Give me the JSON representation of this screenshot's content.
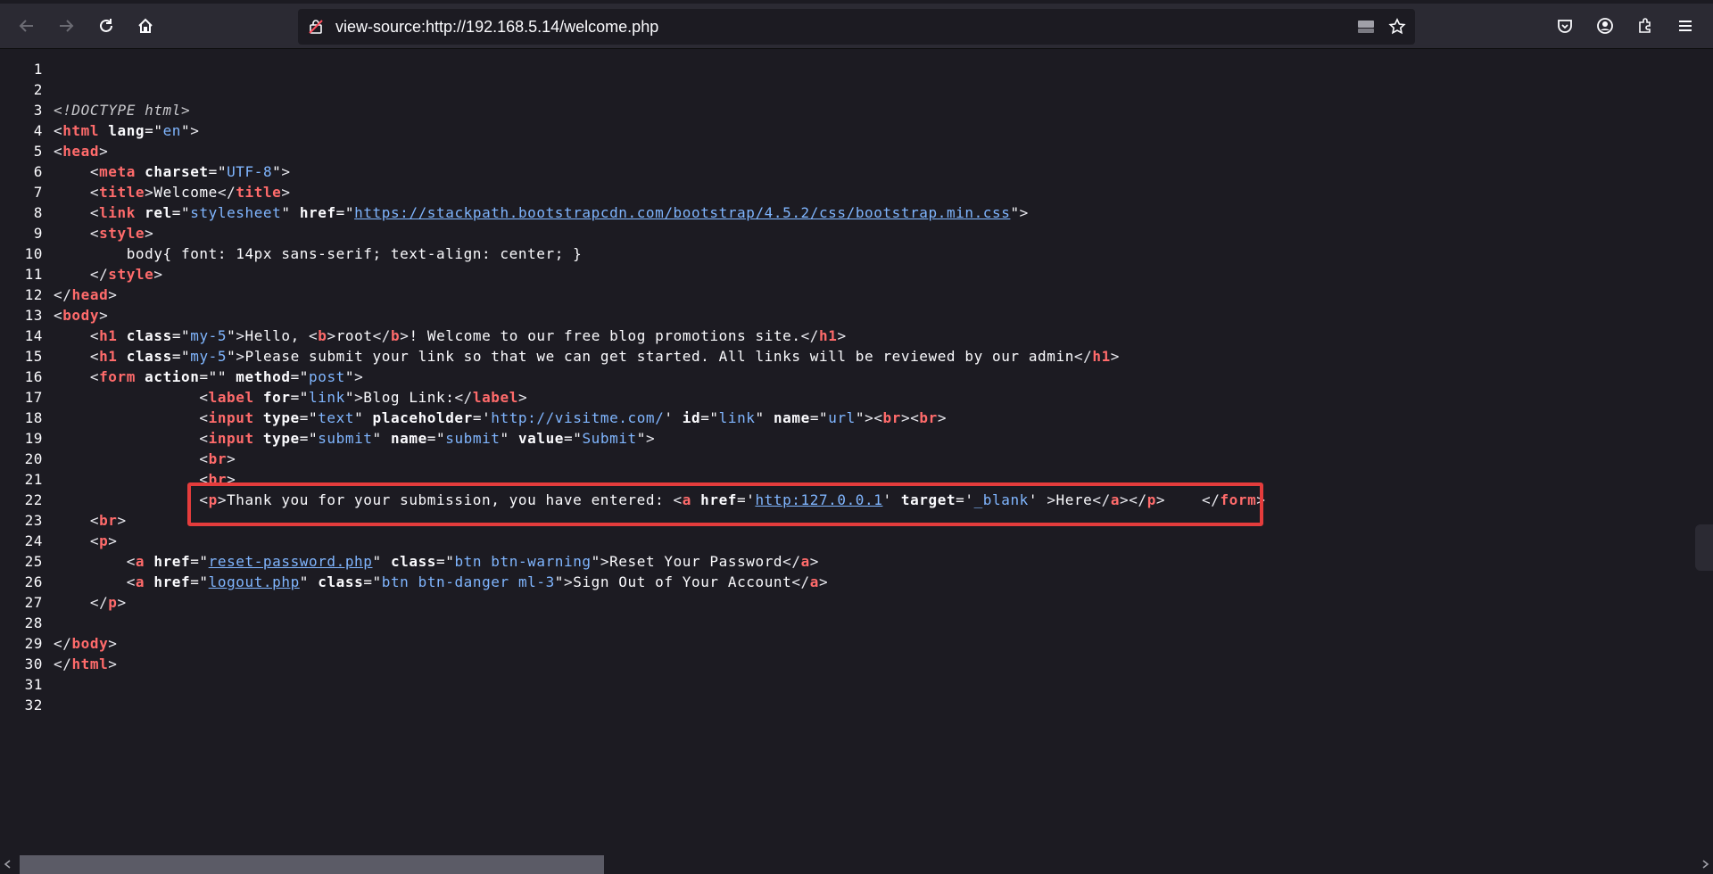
{
  "browser": {
    "url": "view-source:http://192.168.5.14/welcome.php"
  },
  "source_lines": [
    {
      "n": "1",
      "parts": []
    },
    {
      "n": "2",
      "parts": []
    },
    {
      "n": "3",
      "parts": [
        {
          "c": "doctype",
          "t": "<!DOCTYPE html>"
        }
      ]
    },
    {
      "n": "4",
      "parts": [
        {
          "c": "br",
          "t": "<"
        },
        {
          "c": "tag",
          "t": "html"
        },
        {
          "c": "t",
          "t": " "
        },
        {
          "c": "attr",
          "t": "lang"
        },
        {
          "c": "t",
          "t": "=\""
        },
        {
          "c": "val",
          "t": "en"
        },
        {
          "c": "t",
          "t": "\""
        },
        {
          "c": "br",
          "t": ">"
        }
      ]
    },
    {
      "n": "5",
      "parts": [
        {
          "c": "br",
          "t": "<"
        },
        {
          "c": "tag",
          "t": "head"
        },
        {
          "c": "br",
          "t": ">"
        }
      ]
    },
    {
      "n": "6",
      "parts": [
        {
          "c": "t",
          "t": "    "
        },
        {
          "c": "br",
          "t": "<"
        },
        {
          "c": "tag",
          "t": "meta"
        },
        {
          "c": "t",
          "t": " "
        },
        {
          "c": "attr",
          "t": "charset"
        },
        {
          "c": "t",
          "t": "=\""
        },
        {
          "c": "val",
          "t": "UTF-8"
        },
        {
          "c": "t",
          "t": "\""
        },
        {
          "c": "br",
          "t": ">"
        }
      ]
    },
    {
      "n": "7",
      "parts": [
        {
          "c": "t",
          "t": "    "
        },
        {
          "c": "br",
          "t": "<"
        },
        {
          "c": "tag",
          "t": "title"
        },
        {
          "c": "br",
          "t": ">"
        },
        {
          "c": "t",
          "t": "Welcome"
        },
        {
          "c": "br",
          "t": "</"
        },
        {
          "c": "tag",
          "t": "title"
        },
        {
          "c": "br",
          "t": ">"
        }
      ]
    },
    {
      "n": "8",
      "parts": [
        {
          "c": "t",
          "t": "    "
        },
        {
          "c": "br",
          "t": "<"
        },
        {
          "c": "tag",
          "t": "link"
        },
        {
          "c": "t",
          "t": " "
        },
        {
          "c": "attr",
          "t": "rel"
        },
        {
          "c": "t",
          "t": "=\""
        },
        {
          "c": "val",
          "t": "stylesheet"
        },
        {
          "c": "t",
          "t": "\" "
        },
        {
          "c": "attr",
          "t": "href"
        },
        {
          "c": "t",
          "t": "=\""
        },
        {
          "c": "link",
          "t": "https://stackpath.bootstrapcdn.com/bootstrap/4.5.2/css/bootstrap.min.css"
        },
        {
          "c": "t",
          "t": "\""
        },
        {
          "c": "br",
          "t": ">"
        }
      ]
    },
    {
      "n": "9",
      "parts": [
        {
          "c": "t",
          "t": "    "
        },
        {
          "c": "br",
          "t": "<"
        },
        {
          "c": "tag",
          "t": "style"
        },
        {
          "c": "br",
          "t": ">"
        }
      ]
    },
    {
      "n": "10",
      "parts": [
        {
          "c": "t",
          "t": "        body{ font: 14px sans-serif; text-align: center; }"
        }
      ]
    },
    {
      "n": "11",
      "parts": [
        {
          "c": "t",
          "t": "    "
        },
        {
          "c": "br",
          "t": "</"
        },
        {
          "c": "tag",
          "t": "style"
        },
        {
          "c": "br",
          "t": ">"
        }
      ]
    },
    {
      "n": "12",
      "parts": [
        {
          "c": "br",
          "t": "</"
        },
        {
          "c": "tag",
          "t": "head"
        },
        {
          "c": "br",
          "t": ">"
        }
      ]
    },
    {
      "n": "13",
      "parts": [
        {
          "c": "br",
          "t": "<"
        },
        {
          "c": "tag",
          "t": "body"
        },
        {
          "c": "br",
          "t": ">"
        }
      ]
    },
    {
      "n": "14",
      "parts": [
        {
          "c": "t",
          "t": "    "
        },
        {
          "c": "br",
          "t": "<"
        },
        {
          "c": "tag",
          "t": "h1"
        },
        {
          "c": "t",
          "t": " "
        },
        {
          "c": "attr",
          "t": "class"
        },
        {
          "c": "t",
          "t": "=\""
        },
        {
          "c": "val",
          "t": "my-5"
        },
        {
          "c": "t",
          "t": "\""
        },
        {
          "c": "br",
          "t": ">"
        },
        {
          "c": "t",
          "t": "Hello, "
        },
        {
          "c": "br",
          "t": "<"
        },
        {
          "c": "tag",
          "t": "b"
        },
        {
          "c": "br",
          "t": ">"
        },
        {
          "c": "t",
          "t": "root"
        },
        {
          "c": "br",
          "t": "</"
        },
        {
          "c": "tag",
          "t": "b"
        },
        {
          "c": "br",
          "t": ">"
        },
        {
          "c": "t",
          "t": "! Welcome to our free blog promotions site."
        },
        {
          "c": "br",
          "t": "</"
        },
        {
          "c": "tag",
          "t": "h1"
        },
        {
          "c": "br",
          "t": ">"
        }
      ]
    },
    {
      "n": "15",
      "parts": [
        {
          "c": "t",
          "t": "    "
        },
        {
          "c": "br",
          "t": "<"
        },
        {
          "c": "tag",
          "t": "h1"
        },
        {
          "c": "t",
          "t": " "
        },
        {
          "c": "attr",
          "t": "class"
        },
        {
          "c": "t",
          "t": "=\""
        },
        {
          "c": "val",
          "t": "my-5"
        },
        {
          "c": "t",
          "t": "\""
        },
        {
          "c": "br",
          "t": ">"
        },
        {
          "c": "t",
          "t": "Please submit your link so that we can get started. All links will be reviewed by our admin"
        },
        {
          "c": "br",
          "t": "</"
        },
        {
          "c": "tag",
          "t": "h1"
        },
        {
          "c": "br",
          "t": ">"
        }
      ]
    },
    {
      "n": "16",
      "parts": [
        {
          "c": "t",
          "t": "    "
        },
        {
          "c": "br",
          "t": "<"
        },
        {
          "c": "tag",
          "t": "form"
        },
        {
          "c": "t",
          "t": " "
        },
        {
          "c": "attr",
          "t": "action"
        },
        {
          "c": "t",
          "t": "=\"\" "
        },
        {
          "c": "attr",
          "t": "method"
        },
        {
          "c": "t",
          "t": "=\""
        },
        {
          "c": "val",
          "t": "post"
        },
        {
          "c": "t",
          "t": "\""
        },
        {
          "c": "br",
          "t": ">"
        }
      ]
    },
    {
      "n": "17",
      "parts": [
        {
          "c": "t",
          "t": "                "
        },
        {
          "c": "br",
          "t": "<"
        },
        {
          "c": "tag",
          "t": "label"
        },
        {
          "c": "t",
          "t": " "
        },
        {
          "c": "attr",
          "t": "for"
        },
        {
          "c": "t",
          "t": "=\""
        },
        {
          "c": "val",
          "t": "link"
        },
        {
          "c": "t",
          "t": "\""
        },
        {
          "c": "br",
          "t": ">"
        },
        {
          "c": "t",
          "t": "Blog Link:"
        },
        {
          "c": "br",
          "t": "</"
        },
        {
          "c": "tag",
          "t": "label"
        },
        {
          "c": "br",
          "t": ">"
        }
      ]
    },
    {
      "n": "18",
      "parts": [
        {
          "c": "t",
          "t": "                "
        },
        {
          "c": "br",
          "t": "<"
        },
        {
          "c": "tag",
          "t": "input"
        },
        {
          "c": "t",
          "t": " "
        },
        {
          "c": "attr",
          "t": "type"
        },
        {
          "c": "t",
          "t": "=\""
        },
        {
          "c": "val",
          "t": "text"
        },
        {
          "c": "t",
          "t": "\" "
        },
        {
          "c": "attr",
          "t": "placeholder"
        },
        {
          "c": "t",
          "t": "='"
        },
        {
          "c": "val",
          "t": "http://visitme.com/"
        },
        {
          "c": "t",
          "t": "' "
        },
        {
          "c": "attr",
          "t": "id"
        },
        {
          "c": "t",
          "t": "=\""
        },
        {
          "c": "val",
          "t": "link"
        },
        {
          "c": "t",
          "t": "\" "
        },
        {
          "c": "attr",
          "t": "name"
        },
        {
          "c": "t",
          "t": "=\""
        },
        {
          "c": "val",
          "t": "url"
        },
        {
          "c": "t",
          "t": "\""
        },
        {
          "c": "br",
          "t": ">"
        },
        {
          "c": "br",
          "t": "<"
        },
        {
          "c": "tag",
          "t": "br"
        },
        {
          "c": "br",
          "t": ">"
        },
        {
          "c": "br",
          "t": "<"
        },
        {
          "c": "tag",
          "t": "br"
        },
        {
          "c": "br",
          "t": ">"
        }
      ]
    },
    {
      "n": "19",
      "parts": [
        {
          "c": "t",
          "t": "                "
        },
        {
          "c": "br",
          "t": "<"
        },
        {
          "c": "tag",
          "t": "input"
        },
        {
          "c": "t",
          "t": " "
        },
        {
          "c": "attr",
          "t": "type"
        },
        {
          "c": "t",
          "t": "=\""
        },
        {
          "c": "val",
          "t": "submit"
        },
        {
          "c": "t",
          "t": "\" "
        },
        {
          "c": "attr",
          "t": "name"
        },
        {
          "c": "t",
          "t": "=\""
        },
        {
          "c": "val",
          "t": "submit"
        },
        {
          "c": "t",
          "t": "\" "
        },
        {
          "c": "attr",
          "t": "value"
        },
        {
          "c": "t",
          "t": "=\""
        },
        {
          "c": "val",
          "t": "Submit"
        },
        {
          "c": "t",
          "t": "\""
        },
        {
          "c": "br",
          "t": ">"
        }
      ]
    },
    {
      "n": "20",
      "parts": [
        {
          "c": "t",
          "t": "                "
        },
        {
          "c": "br",
          "t": "<"
        },
        {
          "c": "tag",
          "t": "br"
        },
        {
          "c": "br",
          "t": ">"
        }
      ]
    },
    {
      "n": "21",
      "parts": [
        {
          "c": "t",
          "t": "                "
        },
        {
          "c": "br",
          "t": "<"
        },
        {
          "c": "tag",
          "t": "br"
        },
        {
          "c": "br",
          "t": ">"
        }
      ]
    },
    {
      "n": "22",
      "parts": [
        {
          "c": "t",
          "t": "                "
        },
        {
          "c": "br",
          "t": "<"
        },
        {
          "c": "tag",
          "t": "p"
        },
        {
          "c": "br",
          "t": ">"
        },
        {
          "c": "t",
          "t": "Thank you for your submission, you have entered: "
        },
        {
          "c": "br",
          "t": "<"
        },
        {
          "c": "tag",
          "t": "a"
        },
        {
          "c": "t",
          "t": " "
        },
        {
          "c": "attr",
          "t": "href"
        },
        {
          "c": "t",
          "t": "='"
        },
        {
          "c": "link",
          "t": "http:127.0.0.1"
        },
        {
          "c": "t",
          "t": "' "
        },
        {
          "c": "attr",
          "t": "target"
        },
        {
          "c": "t",
          "t": "='"
        },
        {
          "c": "val",
          "t": "_blank"
        },
        {
          "c": "t",
          "t": "' "
        },
        {
          "c": "br",
          "t": ">"
        },
        {
          "c": "t",
          "t": "Here"
        },
        {
          "c": "br",
          "t": "</"
        },
        {
          "c": "tag",
          "t": "a"
        },
        {
          "c": "br",
          "t": ">"
        },
        {
          "c": "br",
          "t": "</"
        },
        {
          "c": "tag",
          "t": "p"
        },
        {
          "c": "br",
          "t": ">"
        },
        {
          "c": "t",
          "t": "    "
        },
        {
          "c": "br",
          "t": "</"
        },
        {
          "c": "tag",
          "t": "form"
        },
        {
          "c": "br",
          "t": ">"
        }
      ]
    },
    {
      "n": "23",
      "parts": [
        {
          "c": "t",
          "t": "    "
        },
        {
          "c": "br",
          "t": "<"
        },
        {
          "c": "tag",
          "t": "br"
        },
        {
          "c": "br",
          "t": ">"
        }
      ]
    },
    {
      "n": "24",
      "parts": [
        {
          "c": "t",
          "t": "    "
        },
        {
          "c": "br",
          "t": "<"
        },
        {
          "c": "tag",
          "t": "p"
        },
        {
          "c": "br",
          "t": ">"
        }
      ]
    },
    {
      "n": "25",
      "parts": [
        {
          "c": "t",
          "t": "        "
        },
        {
          "c": "br",
          "t": "<"
        },
        {
          "c": "tag",
          "t": "a"
        },
        {
          "c": "t",
          "t": " "
        },
        {
          "c": "attr",
          "t": "href"
        },
        {
          "c": "t",
          "t": "=\""
        },
        {
          "c": "link",
          "t": "reset-password.php"
        },
        {
          "c": "t",
          "t": "\" "
        },
        {
          "c": "attr",
          "t": "class"
        },
        {
          "c": "t",
          "t": "=\""
        },
        {
          "c": "val",
          "t": "btn btn-warning"
        },
        {
          "c": "t",
          "t": "\""
        },
        {
          "c": "br",
          "t": ">"
        },
        {
          "c": "t",
          "t": "Reset Your Password"
        },
        {
          "c": "br",
          "t": "</"
        },
        {
          "c": "tag",
          "t": "a"
        },
        {
          "c": "br",
          "t": ">"
        }
      ]
    },
    {
      "n": "26",
      "parts": [
        {
          "c": "t",
          "t": "        "
        },
        {
          "c": "br",
          "t": "<"
        },
        {
          "c": "tag",
          "t": "a"
        },
        {
          "c": "t",
          "t": " "
        },
        {
          "c": "attr",
          "t": "href"
        },
        {
          "c": "t",
          "t": "=\""
        },
        {
          "c": "link",
          "t": "logout.php"
        },
        {
          "c": "t",
          "t": "\" "
        },
        {
          "c": "attr",
          "t": "class"
        },
        {
          "c": "t",
          "t": "=\""
        },
        {
          "c": "val",
          "t": "btn btn-danger ml-3"
        },
        {
          "c": "t",
          "t": "\""
        },
        {
          "c": "br",
          "t": ">"
        },
        {
          "c": "t",
          "t": "Sign Out of Your Account"
        },
        {
          "c": "br",
          "t": "</"
        },
        {
          "c": "tag",
          "t": "a"
        },
        {
          "c": "br",
          "t": ">"
        }
      ]
    },
    {
      "n": "27",
      "parts": [
        {
          "c": "t",
          "t": "    "
        },
        {
          "c": "br",
          "t": "</"
        },
        {
          "c": "tag",
          "t": "p"
        },
        {
          "c": "br",
          "t": ">"
        }
      ]
    },
    {
      "n": "28",
      "parts": []
    },
    {
      "n": "29",
      "parts": [
        {
          "c": "br",
          "t": "</"
        },
        {
          "c": "tag",
          "t": "body"
        },
        {
          "c": "br",
          "t": ">"
        }
      ]
    },
    {
      "n": "30",
      "parts": [
        {
          "c": "br",
          "t": "</"
        },
        {
          "c": "tag",
          "t": "html"
        },
        {
          "c": "br",
          "t": ">"
        }
      ]
    },
    {
      "n": "31",
      "parts": []
    },
    {
      "n": "32",
      "parts": []
    }
  ],
  "colors": {
    "background": "#1c1b22",
    "toolbar": "#2b2a33",
    "tag": "#ff6b6b",
    "value": "#80b6ff",
    "highlight": "#e43c3c"
  }
}
